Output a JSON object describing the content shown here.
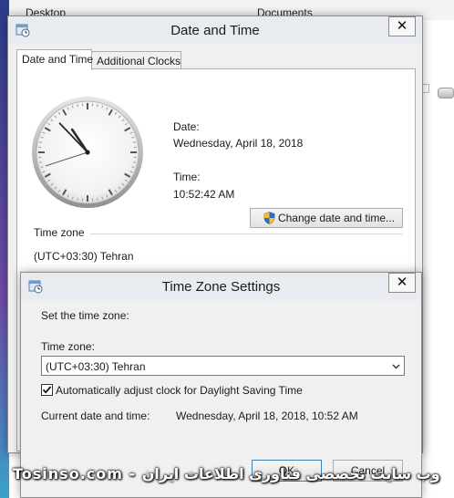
{
  "background": {
    "item_1": "Desktop",
    "item_2": "Documents"
  },
  "date_time_window": {
    "title": "Date and Time",
    "close_glyph": "✕",
    "tabs": [
      {
        "label": "Date and Time",
        "active": true
      },
      {
        "label": "Additional Clocks",
        "active": false
      }
    ],
    "date_label": "Date:",
    "date_value": "Wednesday, April 18, 2018",
    "time_label": "Time:",
    "time_value": "10:52:42 AM",
    "change_button_label": "Change date and time...",
    "time_zone_section_title": "Time zone",
    "time_zone_value": "(UTC+03:30) Tehran",
    "clock_time": {
      "hour": 10,
      "minute": 52,
      "second": 42
    }
  },
  "tz_window": {
    "title": "Time Zone Settings",
    "close_glyph": "✕",
    "heading": "Set the time zone:",
    "time_zone_label": "Time zone:",
    "time_zone_selected": "(UTC+03:30) Tehran",
    "dst_checkbox_label": "Automatically adjust clock for Daylight Saving Time",
    "dst_checked": true,
    "current_label": "Current date and time:",
    "current_value": "Wednesday, April 18, 2018, 10:52 AM",
    "ok_label": "OK",
    "cancel_label": "Cancel"
  },
  "watermark": "Tosinso.com - وب سایت تخصصی فناوری اطلاعات ایران",
  "colors": {
    "window_bg": "#f0f0f0",
    "titlebar_bg": "#e8ecf0",
    "panel_bg": "#ffffff",
    "button_border": "#adadad",
    "default_button_border": "#3c7fb1"
  },
  "icons": {
    "title_icon": "date-time-control-panel-icon",
    "close": "close-icon",
    "uac_shield": "shield-icon",
    "dropdown": "chevron-down-icon",
    "check": "checkmark-icon"
  }
}
